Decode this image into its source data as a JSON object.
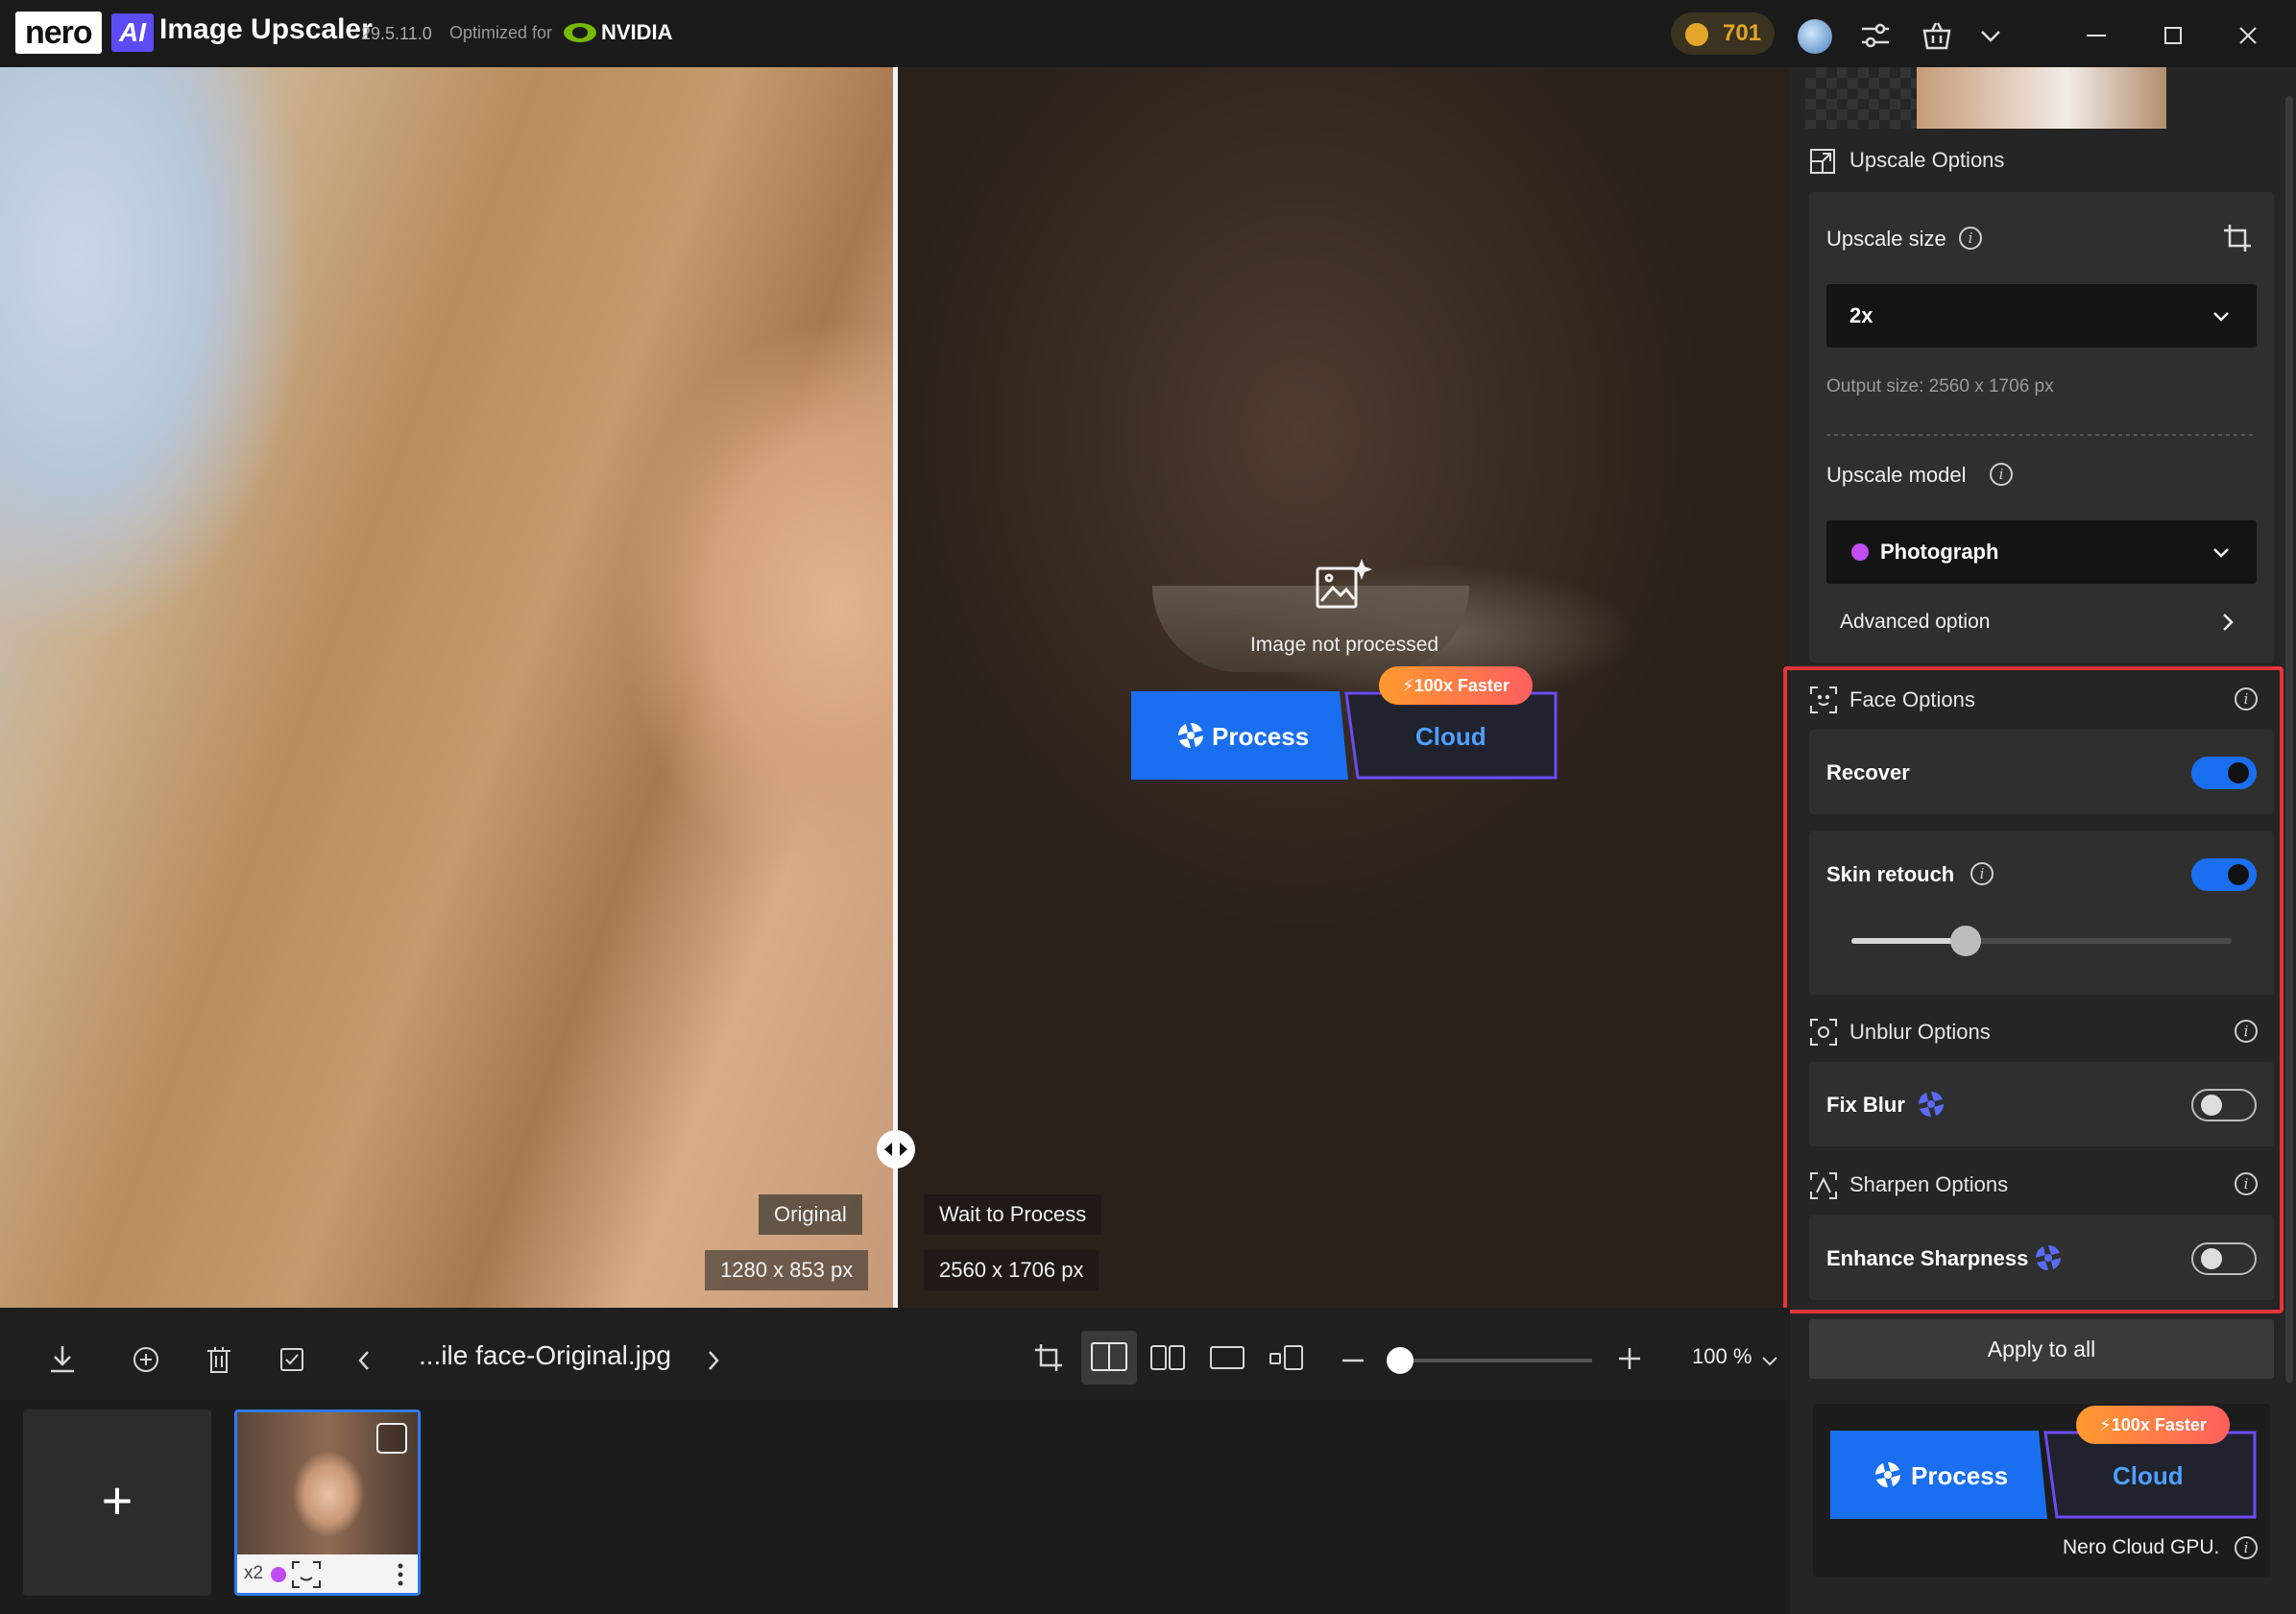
{
  "titlebar": {
    "brand": "nero",
    "ai_badge": "AI",
    "title": "Image Upscaler",
    "version": "29.5.11.0",
    "optimized_for": "Optimized for",
    "nvidia": "NVIDIA",
    "coins": "701"
  },
  "viewer": {
    "left_label": "Original",
    "left_size": "1280 x 853 px",
    "right_label": "Wait to Process",
    "right_size": "2560 x 1706 px",
    "status": "Image not processed",
    "process_label": "Process",
    "cloud_label": "Cloud",
    "faster_badge": "100x Faster"
  },
  "panel": {
    "upscale_options_title": "Upscale Options",
    "upscale_size_label": "Upscale size",
    "upscale_size_value": "2x",
    "output_size": "Output size: 2560 x 1706 px",
    "upscale_model_label": "Upscale model",
    "upscale_model_value": "Photograph",
    "advanced_option": "Advanced option",
    "face_options_title": "Face Options",
    "recover_label": "Recover",
    "recover_on": true,
    "skin_retouch_label": "Skin retouch",
    "skin_retouch_on": true,
    "skin_retouch_level": 0.3,
    "unblur_title": "Unblur Options",
    "fix_blur_label": "Fix Blur",
    "fix_blur_on": false,
    "sharpen_title": "Sharpen Options",
    "enhance_label": "Enhance Sharpness",
    "enhance_on": false,
    "apply_all": "Apply to all",
    "process_label": "Process",
    "cloud_label": "Cloud",
    "faster_badge": "100x Faster",
    "cloud_gpu": "Nero Cloud GPU."
  },
  "bottombar": {
    "filename": "...ile face-Original.jpg",
    "zoom": "100 %",
    "zoom_level": 0.0
  },
  "strip": {
    "add": "+",
    "thumb_scale": "x2"
  },
  "colors": {
    "accent": "#1a6ff0",
    "cloud_border": "#6b4cf3",
    "highlight": "#e5343a",
    "coin": "#e3a52a"
  }
}
